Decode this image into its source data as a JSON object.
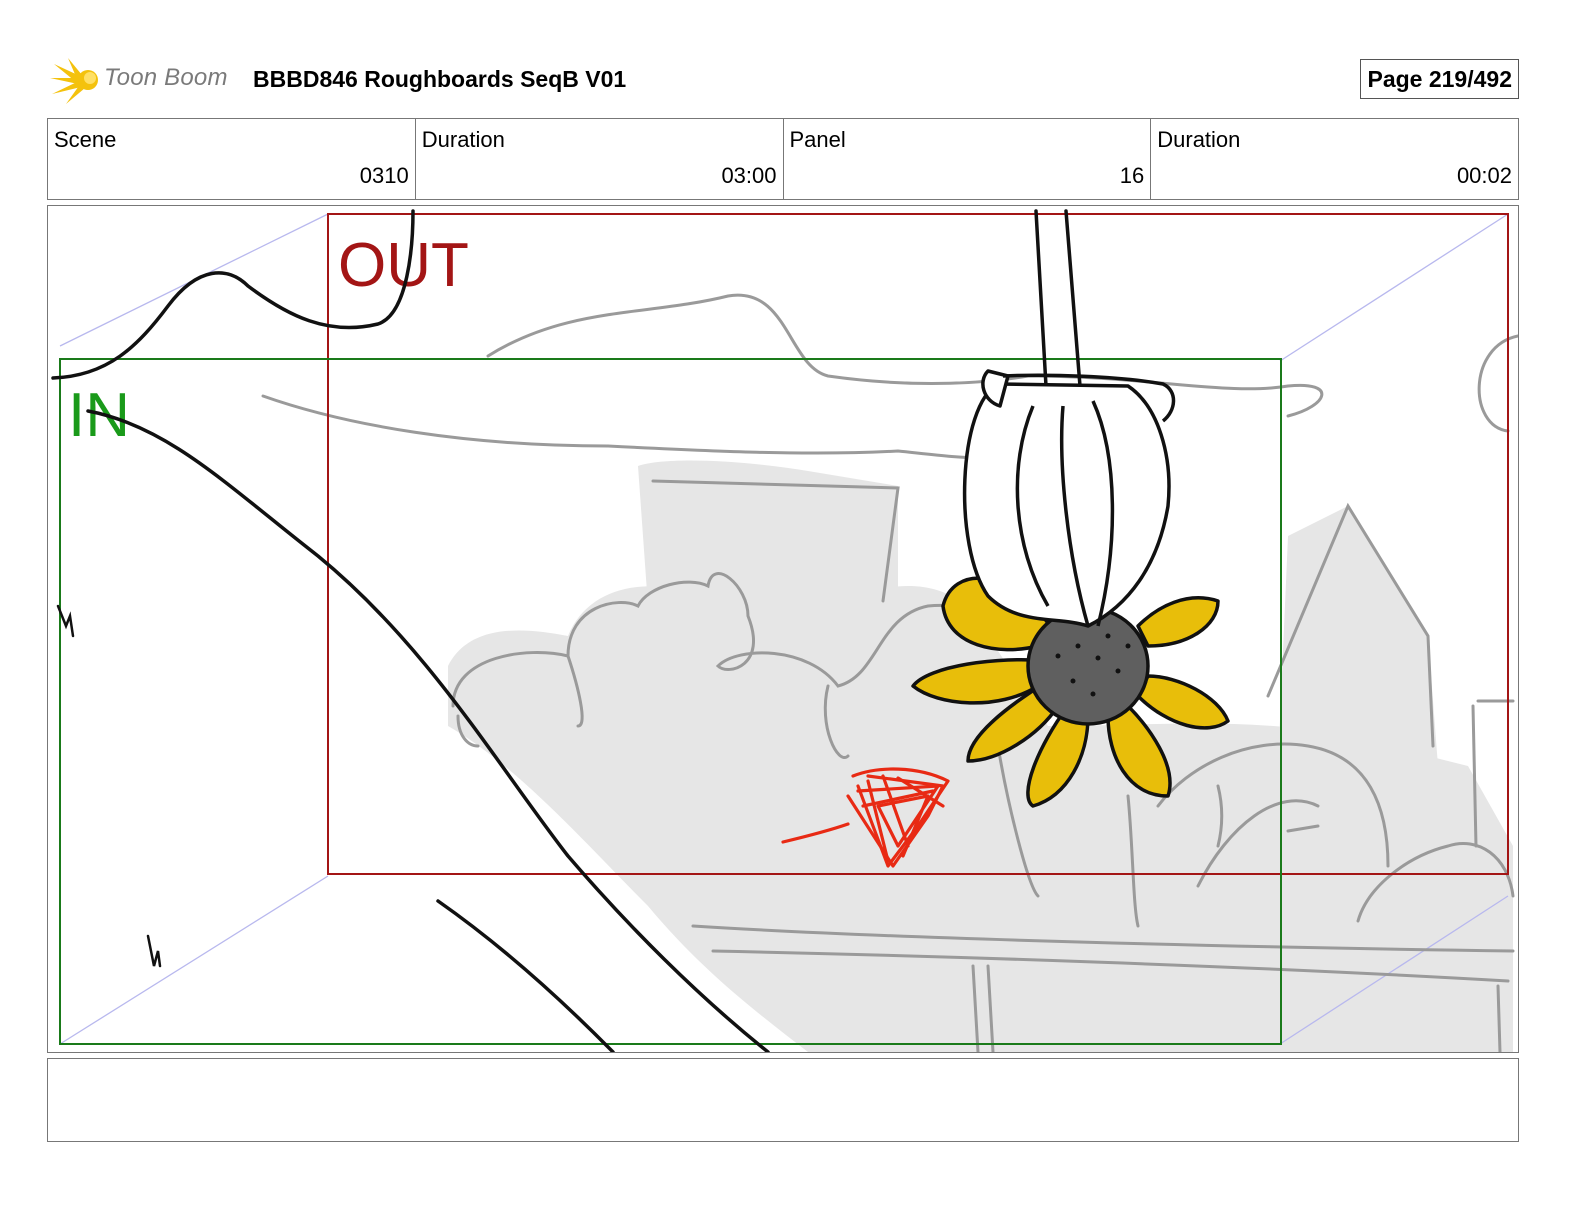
{
  "header": {
    "logo_text": "Toon Boom",
    "project_title": "BBBD846 Roughboards SeqB V01",
    "page_label": "Page 219/492"
  },
  "info": {
    "scene_label": "Scene",
    "scene_value": "0310",
    "scene_duration_label": "Duration",
    "scene_duration_value": "03:00",
    "panel_label": "Panel",
    "panel_value": "16",
    "panel_duration_label": "Duration",
    "panel_duration_value": "00:02"
  },
  "panel": {
    "out_label": "OUT",
    "in_label": "IN",
    "out_color": "#a31515",
    "in_color": "#1a9a1a",
    "sunflower_color": "#e8be0a"
  },
  "notes": {
    "text": ""
  }
}
